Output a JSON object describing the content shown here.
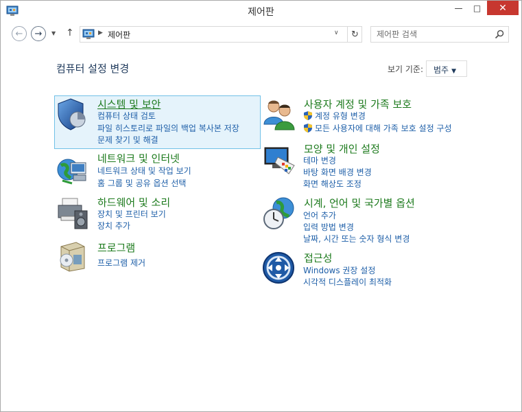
{
  "window": {
    "title": "제어판",
    "minimize": "—",
    "maximize": "□",
    "close": "✕"
  },
  "nav": {
    "address": "제어판",
    "search_placeholder": "제어판 검색"
  },
  "page": {
    "heading": "컴퓨터 설정 변경",
    "viewby_label": "보기 기준:",
    "viewby_value": "범주"
  },
  "categories": [
    {
      "title": "시스템 및 보안",
      "icon": "shield-pie-icon",
      "links": [
        "컴퓨터 상태 검토",
        "파일 히스토리로 파일의 백업 복사본 저장",
        "문제 찾기 및 해결"
      ]
    },
    {
      "title": "네트워크 및 인터넷",
      "icon": "network-globe-icon",
      "links": [
        "네트워크 상태 및 작업 보기",
        "홈 그룹 및 공유 옵션 선택"
      ]
    },
    {
      "title": "하드웨어 및 소리",
      "icon": "printer-speaker-icon",
      "links": [
        "장치 및 프린터 보기",
        "장치 추가"
      ]
    },
    {
      "title": "프로그램",
      "icon": "programs-box-icon",
      "links": [
        "프로그램 제거"
      ]
    },
    {
      "title": "사용자 계정 및 가족 보호",
      "icon": "users-icon",
      "links": [
        "계정 유형 변경",
        "모든 사용자에 대해 가족 보호 설정 구성"
      ]
    },
    {
      "title": "모양 및 개인 설정",
      "icon": "monitor-palette-icon",
      "links": [
        "테마 변경",
        "바탕 화면 배경 변경",
        "화면 해상도 조정"
      ]
    },
    {
      "title": "시계, 언어 및 국가별 옵션",
      "icon": "clock-globe-icon",
      "links": [
        "언어 추가",
        "입력 방법 변경",
        "날짜, 시간 또는 숫자 형식 변경"
      ]
    },
    {
      "title": "접근성",
      "icon": "ease-of-access-icon",
      "links": [
        "Windows 권장 설정",
        "시각적 디스플레이 최적화"
      ]
    }
  ]
}
